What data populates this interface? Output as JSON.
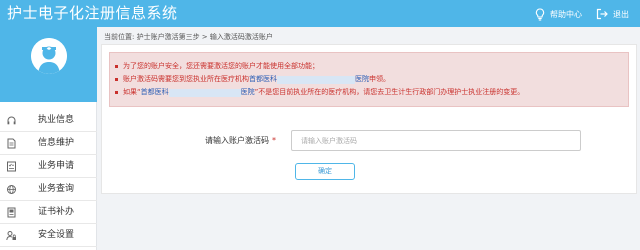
{
  "header": {
    "app_title": "护士电子化注册信息系统",
    "help_label": "帮助中心",
    "logout_label": "退出"
  },
  "sidebar": {
    "items": [
      {
        "label": "执业信息",
        "icon": "headset-icon"
      },
      {
        "label": "信息维护",
        "icon": "document-icon"
      },
      {
        "label": "业务申请",
        "icon": "checklist-icon"
      },
      {
        "label": "业务查询",
        "icon": "globe-icon"
      },
      {
        "label": "证书补办",
        "icon": "certificate-icon"
      },
      {
        "label": "安全设置",
        "icon": "user-lock-icon"
      }
    ]
  },
  "breadcrumb": "当前位置: 护士账户激活第三步 > 输入激活码激活账户",
  "notice": {
    "line1": "为了您的账户安全，您还需要激活您的账户才能使用全部功能；",
    "line2_prefix": "账户激活码需要您到您执业所在医疗机构 ",
    "line2_org": "首都医科",
    "line2_org_suffix": "医院",
    "line2_end": " 申领。",
    "line3_prefix": "如果“",
    "line3_org": "首都医科",
    "line3_org_suffix": "医院",
    "line3_end": "”不是您目前执业所在的医疗机构，请您去卫生计生行政部门办理护士执业注册的变更。"
  },
  "form": {
    "label": "请输入账户激活码",
    "required_mark": "*",
    "placeholder": "请输入账户激活码",
    "value": "",
    "confirm_label": "确定"
  },
  "colors": {
    "header_bg": "#4fb6e8",
    "notice_bg": "#f2dede",
    "notice_text": "#c9302c",
    "link_text": "#2c5fb6"
  }
}
